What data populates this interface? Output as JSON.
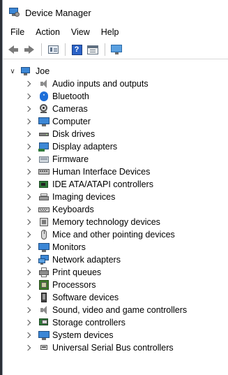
{
  "window": {
    "title": "Device Manager"
  },
  "menu": [
    "File",
    "Action",
    "View",
    "Help"
  ],
  "toolbar": [
    "back-arrow-icon",
    "forward-arrow-icon",
    "properties-icon",
    "help-icon",
    "view-icon",
    "scan-hardware-icon"
  ],
  "tree": {
    "root": {
      "label": "Joe",
      "expanded": true
    },
    "nodes": [
      {
        "label": "Audio inputs and outputs",
        "icon": "speaker-icon"
      },
      {
        "label": "Bluetooth",
        "icon": "bluetooth-icon"
      },
      {
        "label": "Cameras",
        "icon": "camera-icon"
      },
      {
        "label": "Computer",
        "icon": "computer-icon"
      },
      {
        "label": "Disk drives",
        "icon": "disk-drive-icon"
      },
      {
        "label": "Display adapters",
        "icon": "display-adapter-icon"
      },
      {
        "label": "Firmware",
        "icon": "firmware-icon"
      },
      {
        "label": "Human Interface Devices",
        "icon": "hid-icon"
      },
      {
        "label": "IDE ATA/ATAPI controllers",
        "icon": "ide-controller-icon"
      },
      {
        "label": "Imaging devices",
        "icon": "imaging-icon"
      },
      {
        "label": "Keyboards",
        "icon": "keyboard-icon"
      },
      {
        "label": "Memory technology devices",
        "icon": "memory-icon"
      },
      {
        "label": "Mice and other pointing devices",
        "icon": "mouse-icon"
      },
      {
        "label": "Monitors",
        "icon": "monitor-icon"
      },
      {
        "label": "Network adapters",
        "icon": "network-icon"
      },
      {
        "label": "Print queues",
        "icon": "printer-icon"
      },
      {
        "label": "Processors",
        "icon": "processor-icon"
      },
      {
        "label": "Software devices",
        "icon": "software-device-icon"
      },
      {
        "label": "Sound, video and game controllers",
        "icon": "sound-icon"
      },
      {
        "label": "Storage controllers",
        "icon": "storage-icon"
      },
      {
        "label": "System devices",
        "icon": "system-device-icon"
      },
      {
        "label": "Universal Serial Bus controllers",
        "icon": "usb-icon"
      }
    ]
  },
  "colors": {
    "accent": "#3c87d6",
    "bluetooth": "#1e6fd9",
    "processor": "#3f7a2a"
  }
}
